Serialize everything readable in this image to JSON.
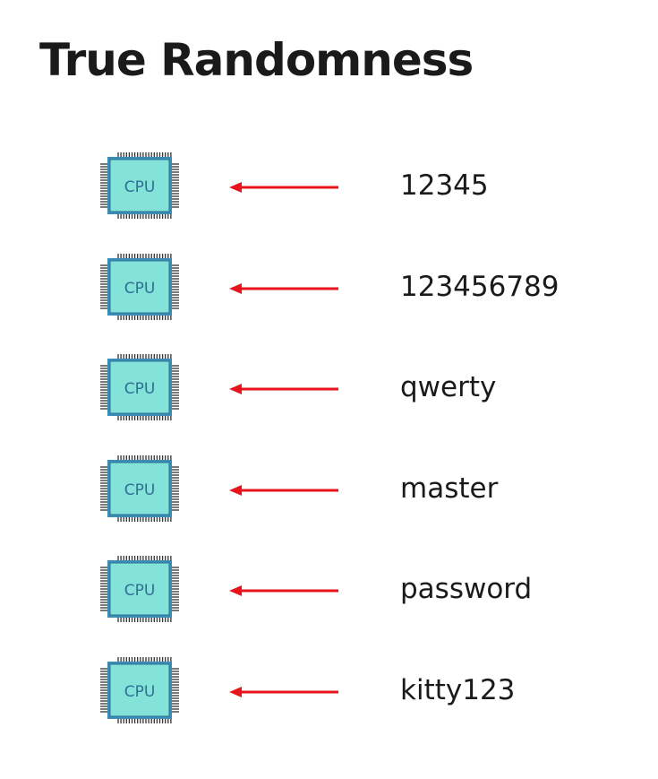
{
  "title": "True Randomness",
  "chip_label": "CPU",
  "colors": {
    "chip_fill": "#84e3d8",
    "chip_border": "#3b8db5",
    "arrow": "#e8131b",
    "text": "#1a1a1a"
  },
  "rows": [
    {
      "label": "12345"
    },
    {
      "label": "123456789"
    },
    {
      "label": "qwerty"
    },
    {
      "label": "master"
    },
    {
      "label": "password"
    },
    {
      "label": "kitty123"
    }
  ]
}
